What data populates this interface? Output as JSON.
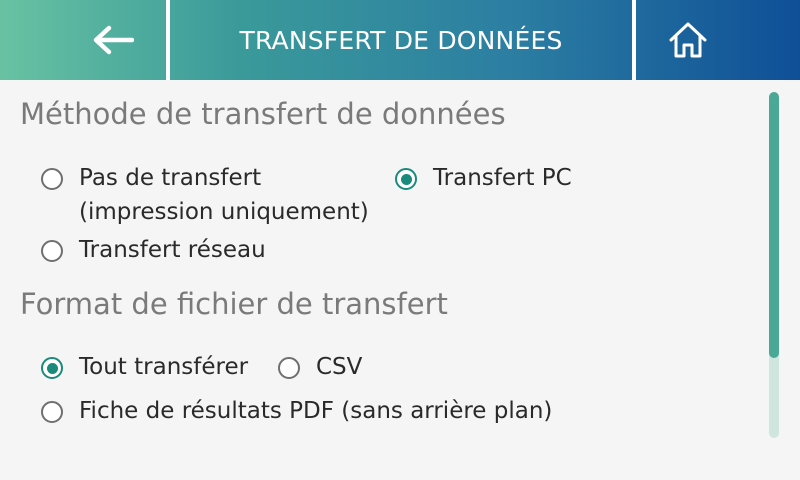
{
  "header": {
    "title": "TRANSFERT DE DONNÉES",
    "back_icon": "arrow-left-icon",
    "home_icon": "home-icon"
  },
  "sections": {
    "method": {
      "title": "Méthode de transfert de données",
      "options": [
        {
          "label_line1": "Pas de transfert",
          "label_line2": "(impression uniquement)",
          "checked": false
        },
        {
          "label": "Transfert PC",
          "checked": true
        },
        {
          "label": "Transfert réseau",
          "checked": false
        }
      ]
    },
    "format": {
      "title": "Format de fichier de transfert",
      "options": [
        {
          "label": "Tout transférer",
          "checked": true
        },
        {
          "label": "CSV",
          "checked": false
        },
        {
          "label": "Fiche de résultats PDF (sans arrière plan)",
          "checked": false
        }
      ]
    }
  },
  "colors": {
    "accent": "#1a8a7a",
    "header_start": "#68c2a2",
    "header_end": "#0f4f97"
  },
  "scrollbar": {
    "position_fraction": 0.0,
    "visible_fraction": 0.77
  }
}
